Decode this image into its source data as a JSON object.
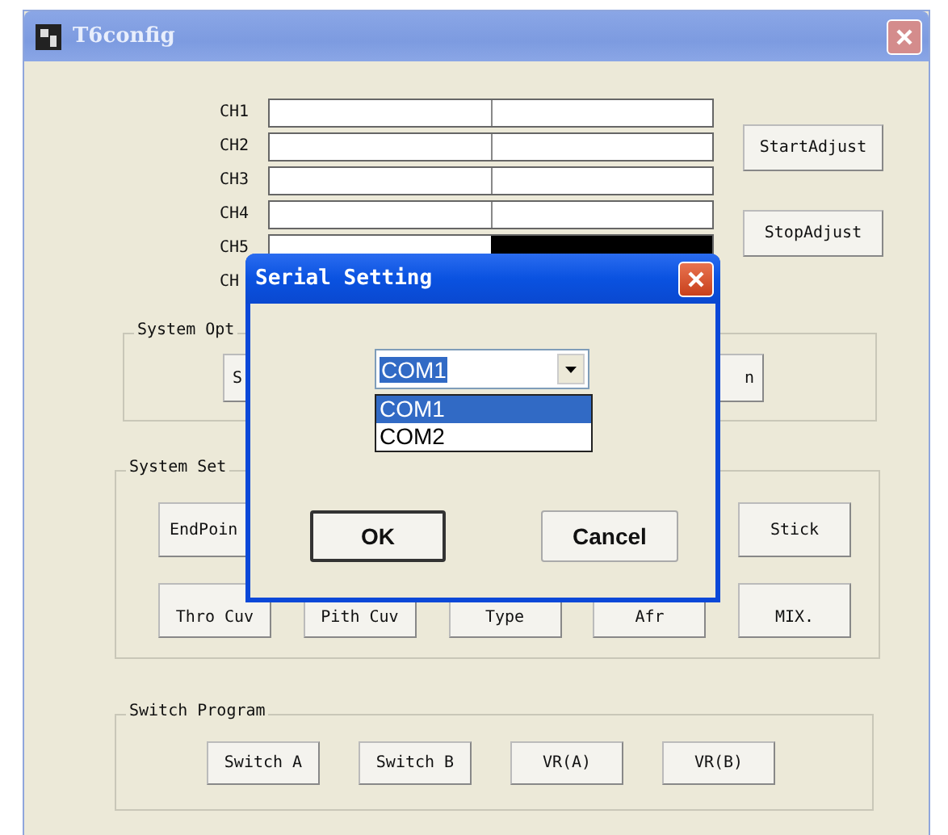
{
  "main_window": {
    "title": "T6config",
    "channels": [
      {
        "label": "CH1",
        "level": 0.5
      },
      {
        "label": "CH2",
        "level": 0.5
      },
      {
        "label": "CH3",
        "level": 0.5
      },
      {
        "label": "CH4",
        "level": 0.5
      },
      {
        "label": "CH5",
        "level": 1
      },
      {
        "label": "CH"
      }
    ],
    "adjust_buttons": [
      "StartAdjust",
      "StopAdjust"
    ],
    "system_options": {
      "title": "System Opt",
      "buttons": [
        "S",
        "n"
      ]
    },
    "system_settings": {
      "title": "System Set",
      "rows": [
        [
          "EndPoin",
          "",
          "",
          "",
          "Stick"
        ],
        [
          "Thro Cuv",
          "Pith Cuv",
          "Type",
          "Afr",
          "MIX."
        ]
      ]
    },
    "switch_program": {
      "title": "Switch Program",
      "buttons": [
        "Switch A",
        "Switch B",
        "VR(A)",
        "VR(B)"
      ]
    }
  },
  "dialog": {
    "title": "Serial Setting",
    "port": {
      "value": "COM1",
      "options": [
        {
          "label": "COM1",
          "selected": true
        },
        {
          "label": "COM2",
          "selected": false
        }
      ]
    },
    "buttons": [
      {
        "label": "OK",
        "default": true
      },
      {
        "label": "Cancel",
        "default": false
      }
    ]
  }
}
